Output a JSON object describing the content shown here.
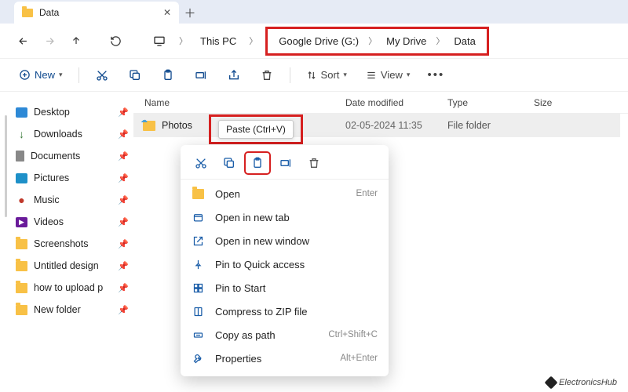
{
  "tab": {
    "title": "Data"
  },
  "breadcrumb": {
    "root": "This PC",
    "parts": [
      "Google Drive (G:)",
      "My Drive",
      "Data"
    ]
  },
  "toolbar": {
    "new": "New",
    "sort": "Sort",
    "view": "View"
  },
  "columns": {
    "name": "Name",
    "date": "Date modified",
    "type": "Type",
    "size": "Size"
  },
  "sidebar": {
    "items": [
      {
        "label": "Desktop"
      },
      {
        "label": "Downloads"
      },
      {
        "label": "Documents"
      },
      {
        "label": "Pictures"
      },
      {
        "label": "Music"
      },
      {
        "label": "Videos"
      },
      {
        "label": "Screenshots"
      },
      {
        "label": "Untitled design"
      },
      {
        "label": "how to upload p"
      },
      {
        "label": "New folder"
      }
    ]
  },
  "row": {
    "name": "Photos",
    "date": "02-05-2024 11:35",
    "type": "File folder"
  },
  "tooltip": "Paste (Ctrl+V)",
  "ctx": {
    "open": "Open",
    "open_sc": "Enter",
    "open_tab": "Open in new tab",
    "open_win": "Open in new window",
    "pin_qa": "Pin to Quick access",
    "pin_start": "Pin to Start",
    "zip": "Compress to ZIP file",
    "copy_path": "Copy as path",
    "copy_path_sc": "Ctrl+Shift+C",
    "props": "Properties",
    "props_sc": "Alt+Enter"
  },
  "watermark": "ElectronicsHub"
}
